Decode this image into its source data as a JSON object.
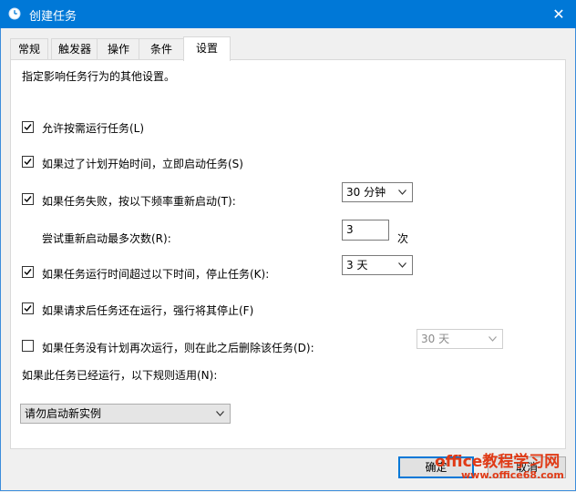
{
  "window": {
    "title": "创建任务",
    "close_glyph": "✕"
  },
  "tabs": [
    {
      "label": "常规"
    },
    {
      "label": "触发器"
    },
    {
      "label": "操作"
    },
    {
      "label": "条件"
    },
    {
      "label": "设置",
      "active": true
    }
  ],
  "settings": {
    "description": "指定影响任务行为的其他设置。",
    "allow_on_demand": {
      "label": "允许按需运行任务(L)",
      "checked": true
    },
    "run_asap_missed": {
      "label": "如果过了计划开始时间，立即启动任务(S)",
      "checked": true
    },
    "restart_on_fail": {
      "label": "如果任务失败，按以下频率重新启动(T):",
      "checked": true,
      "interval": "30 分钟"
    },
    "restart_attempts": {
      "label": "尝试重新启动最多次数(R):",
      "value": "3",
      "unit": "次"
    },
    "stop_if_runs_longer": {
      "label": "如果任务运行时间超过以下时间，停止任务(K):",
      "checked": true,
      "duration": "3 天"
    },
    "force_stop": {
      "label": "如果请求后任务还在运行，强行将其停止(F)",
      "checked": true
    },
    "delete_if_not_scheduled": {
      "label": "如果任务没有计划再次运行，则在此之后删除该任务(D):",
      "checked": false,
      "after": "30 天"
    },
    "already_running_rule": {
      "label": "如果此任务已经运行，以下规则适用(N):",
      "value": "请勿启动新实例"
    }
  },
  "buttons": {
    "ok": "确定",
    "cancel": "取消"
  },
  "watermark": {
    "line1": "office教程学习网",
    "line2": "www.office68.com"
  }
}
